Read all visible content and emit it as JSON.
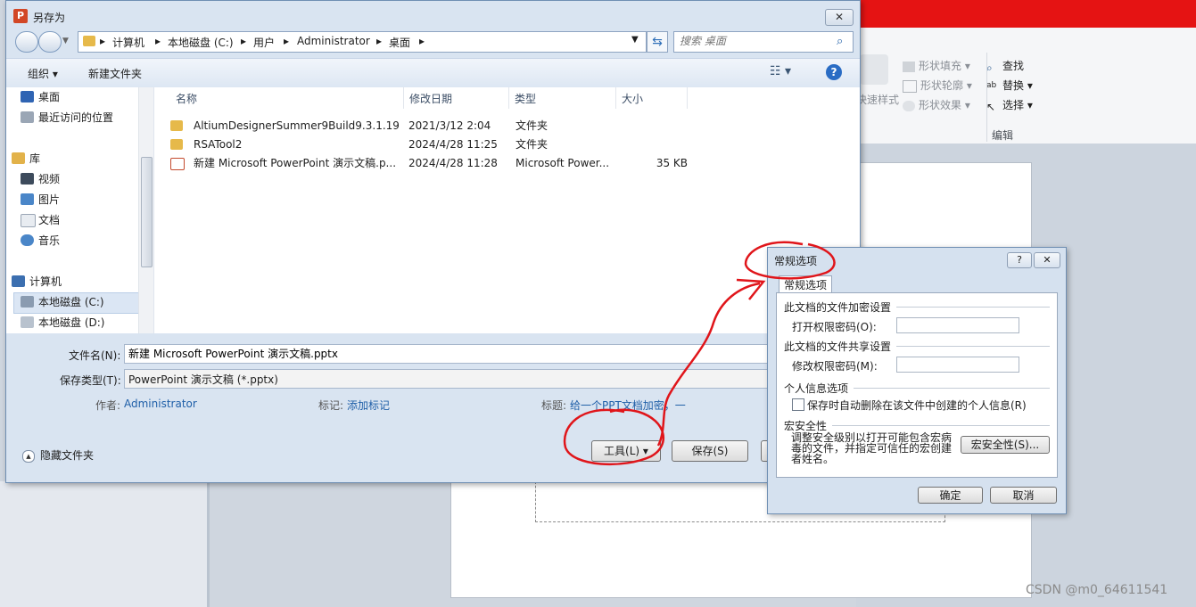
{
  "powerpoint": {
    "ribbon": {
      "quick_styles": "快速样式",
      "shape_fill": "形状填充",
      "shape_outline": "形状轮廓",
      "shape_effects": "形状效果",
      "find": "查找",
      "replace": "替换",
      "select": "选择",
      "editing_group": "编辑"
    }
  },
  "saveas": {
    "title": "另存为",
    "close_label": "✕",
    "address": [
      "计算机",
      "本地磁盘 (C:)",
      "用户",
      "Administrator",
      "桌面"
    ],
    "search_placeholder": "搜索 桌面",
    "toolbar": {
      "organize": "组织 ▾",
      "new_folder": "新建文件夹"
    },
    "nav": {
      "favorites": [
        {
          "label": "桌面"
        },
        {
          "label": "最近访问的位置"
        }
      ],
      "library_label": "库",
      "libraries": [
        {
          "label": "视频"
        },
        {
          "label": "图片"
        },
        {
          "label": "文档"
        },
        {
          "label": "音乐"
        }
      ],
      "computer_label": "计算机",
      "drives": [
        {
          "label": "本地磁盘 (C:)"
        },
        {
          "label": "本地磁盘 (D:)"
        }
      ]
    },
    "columns": {
      "name": "名称",
      "modified": "修改日期",
      "type": "类型",
      "size": "大小"
    },
    "files": [
      {
        "name": "AltiumDesignerSummer9Build9.3.1.19...",
        "modified": "2021/3/12 2:04",
        "type": "文件夹",
        "size": ""
      },
      {
        "name": "RSATool2",
        "modified": "2024/4/28 11:25",
        "type": "文件夹",
        "size": ""
      },
      {
        "name": "新建 Microsoft PowerPoint 演示文稿.p...",
        "modified": "2024/4/28 11:28",
        "type": "Microsoft Power...",
        "size": "35 KB"
      }
    ],
    "form": {
      "filename_label": "文件名(N):",
      "filename_value": "新建 Microsoft PowerPoint 演示文稿.pptx",
      "filetype_label": "保存类型(T):",
      "filetype_value": "PowerPoint 演示文稿 (*.pptx)",
      "author_label": "作者:",
      "author_value": "Administrator",
      "tags_label": "标记:",
      "tags_value": "添加标记",
      "title_label": "标题:",
      "title_value": "给一个PPT文档加密，一"
    },
    "hide_folders": "隐藏文件夹",
    "tools_button": "工具(L)",
    "save_button": "保存(S)"
  },
  "options": {
    "title": "常规选项",
    "help_btn": "?",
    "close_btn": "✕",
    "tab": "常规选项",
    "encryption_section": "此文档的文件加密设置",
    "open_password_label": "打开权限密码(O):",
    "sharing_section": "此文档的文件共享设置",
    "modify_password_label": "修改权限密码(M):",
    "privacy_section": "个人信息选项",
    "remove_info_label": "保存时自动删除在该文件中创建的个人信息(R)",
    "macro_section": "宏安全性",
    "macro_text": "调整安全级别以打开可能包含宏病毒的文件，并指定可信任的宏创建者姓名。",
    "macro_button": "宏安全性(S)...",
    "ok": "确定",
    "cancel": "取消"
  },
  "watermark": "CSDN @m0_64611541",
  "colors": {
    "annotation": "#e0151a",
    "ppt_titlebar": "#e51313",
    "link": "#1f5fa8"
  }
}
